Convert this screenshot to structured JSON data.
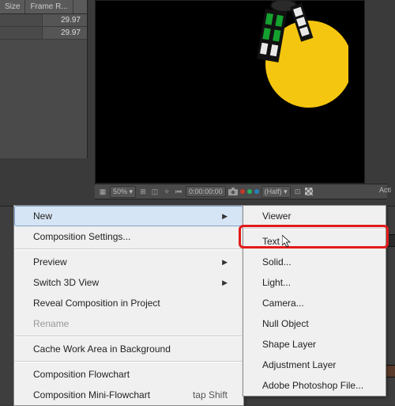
{
  "project_panel": {
    "headers": [
      "Size",
      "Frame R..."
    ],
    "rows": [
      {
        "framerate": "29.97"
      },
      {
        "framerate": "29.97"
      }
    ]
  },
  "statusbar": {
    "zoom": "50%",
    "time": "0:00:00:00",
    "quality": "(Half)"
  },
  "right_label": "Acti",
  "menu1": {
    "items": [
      {
        "label": "New",
        "submenu": true,
        "selected": true
      },
      {
        "label": "Composition Settings..."
      },
      {
        "sep": true
      },
      {
        "label": "Preview",
        "submenu": true
      },
      {
        "label": "Switch 3D View",
        "submenu": true
      },
      {
        "label": "Reveal Composition in Project"
      },
      {
        "label": "Rename",
        "gray": true
      },
      {
        "sep": true
      },
      {
        "label": "Cache Work Area in Background"
      },
      {
        "sep": true
      },
      {
        "label": "Composition Flowchart"
      },
      {
        "label": "Composition Mini-Flowchart",
        "shortcut": "tap Shift"
      }
    ]
  },
  "menu2": {
    "items": [
      {
        "label": "Viewer"
      },
      {
        "sep": true
      },
      {
        "label": "Text",
        "highlight": true
      },
      {
        "label": "Solid..."
      },
      {
        "label": "Light..."
      },
      {
        "label": "Camera..."
      },
      {
        "label": "Null Object"
      },
      {
        "label": "Shape Layer"
      },
      {
        "label": "Adjustment Layer"
      },
      {
        "label": "Adobe Photoshop File..."
      }
    ]
  }
}
